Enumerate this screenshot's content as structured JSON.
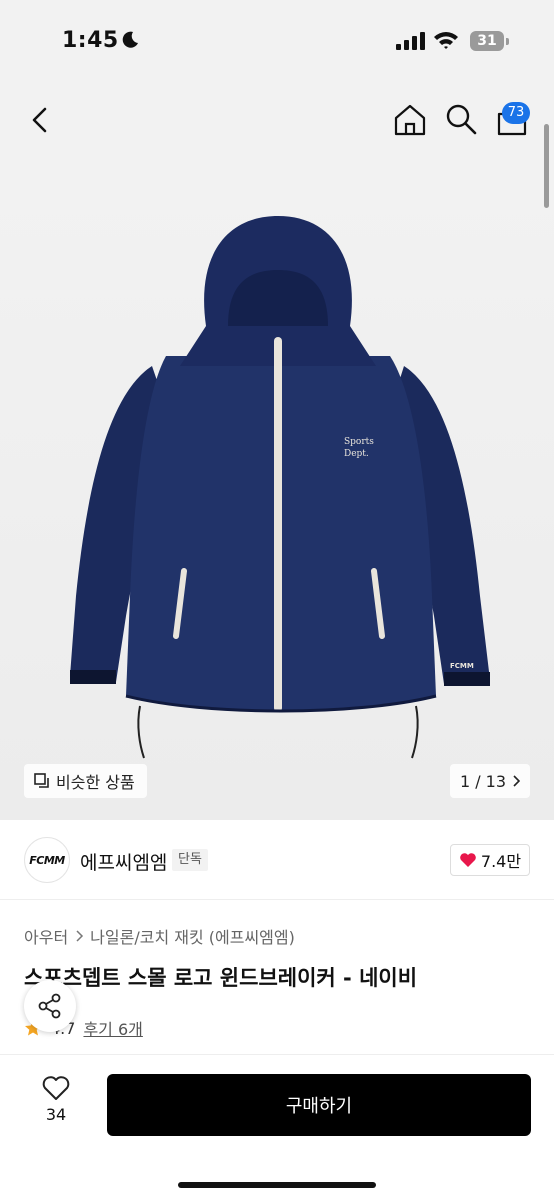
{
  "status_bar": {
    "time": "1:45",
    "battery": "31"
  },
  "header": {
    "cart_count": "73"
  },
  "gallery": {
    "chest_logo_line1": "Sports",
    "chest_logo_line2": "Dept.",
    "cuff_label": "FCMM",
    "similar_label": "비슷한 상품",
    "pager": "1 / 13"
  },
  "brand": {
    "logo_text": "FCMM",
    "name": "에프씨엠엠",
    "badge": "단독",
    "likes": "7.4만"
  },
  "breadcrumb": {
    "category": "아우터",
    "subcategory": "나일론/코치 재킷 (에프씨엠엠)"
  },
  "product": {
    "title": "스포츠뎁트 스몰 로고 윈드브레이커 - 네이비",
    "rating": "4.7",
    "reviews": "후기 6개"
  },
  "bottom": {
    "like_count": "34",
    "buy_label": "구매하기"
  },
  "colors": {
    "jacket": "#1b2a5c",
    "zipper": "#e9e5dc",
    "accent_heart": "#e8174b",
    "badge": "#1a73e8"
  }
}
